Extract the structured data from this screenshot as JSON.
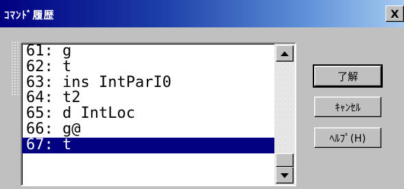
{
  "window": {
    "title": "ｺﾏﾝﾄﾞ履歴",
    "close_label": "X"
  },
  "history": {
    "items": [
      {
        "label": "61: g"
      },
      {
        "label": "62: t"
      },
      {
        "label": "63: ins IntParI0"
      },
      {
        "label": "64: t2"
      },
      {
        "label": "65: d IntLoc"
      },
      {
        "label": "66: g@"
      },
      {
        "label": "67: t"
      }
    ],
    "selected_index": 6
  },
  "buttons": {
    "ok_label": "了解",
    "cancel_label": "ｷｬﾝｾﾙ",
    "help_label": "ﾍﾙﾌﾟ(H)"
  },
  "icons": {
    "scroll_up": "arrow-up-icon",
    "scroll_down": "arrow-down-icon"
  },
  "colors": {
    "selection": "#000080",
    "title_gradient_start": "#000080",
    "title_gradient_end": "#a6caf0"
  }
}
